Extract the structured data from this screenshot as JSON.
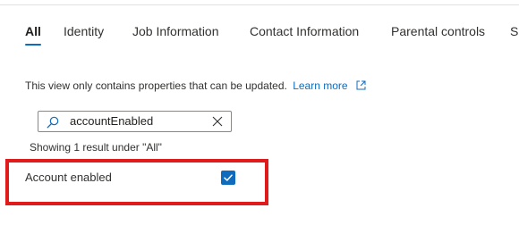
{
  "tabs": [
    {
      "label": "All",
      "active": true
    },
    {
      "label": "Identity",
      "active": false
    },
    {
      "label": "Job Information",
      "active": false
    },
    {
      "label": "Contact Information",
      "active": false
    },
    {
      "label": "Parental controls",
      "active": false
    },
    {
      "label": "Se",
      "active": false
    }
  ],
  "info": {
    "text": "This view only contains properties that can be updated.",
    "link_label": "Learn more",
    "link_icon": "external-link-icon"
  },
  "search": {
    "value": "accountEnabled",
    "icon": "search-icon",
    "clear_icon": "close-icon"
  },
  "results": {
    "summary": "Showing 1 result under \"All\""
  },
  "property": {
    "label": "Account enabled",
    "checked": true
  },
  "colors": {
    "accent": "#0f6cbd",
    "highlight_border": "#e01b1b",
    "text": "#323130"
  }
}
